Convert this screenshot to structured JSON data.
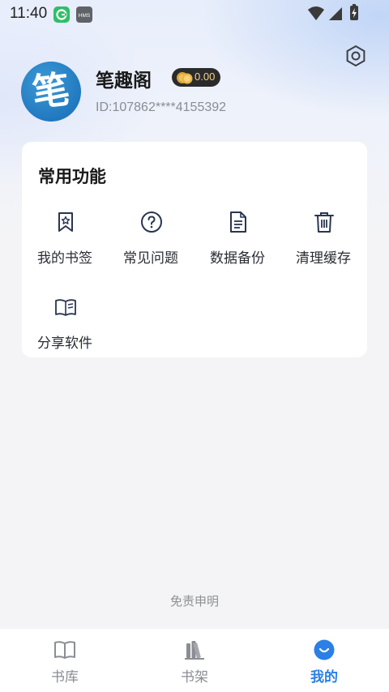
{
  "status_bar": {
    "time": "11:40",
    "app_icon_1": "browser-app-icon",
    "app_icon_2": "HMS"
  },
  "profile": {
    "avatar_glyph": "笔",
    "name": "笔趣阁",
    "coins": "0.00",
    "id_text": "ID:107862****4155392"
  },
  "functions": {
    "title": "常用功能",
    "items": [
      {
        "label": "我的书签",
        "icon": "bookmark-icon"
      },
      {
        "label": "常见问题",
        "icon": "help-icon"
      },
      {
        "label": "数据备份",
        "icon": "document-icon"
      },
      {
        "label": "清理缓存",
        "icon": "trash-icon"
      },
      {
        "label": "分享软件",
        "icon": "book-share-icon"
      }
    ]
  },
  "disclaimer": "免责申明",
  "bottom_nav": [
    {
      "label": "书库",
      "icon": "open-book-icon",
      "active": false
    },
    {
      "label": "书架",
      "icon": "bookshelf-icon",
      "active": false
    },
    {
      "label": "我的",
      "icon": "smile-icon",
      "active": true
    }
  ],
  "colors": {
    "accent": "#2b7fe6",
    "avatar_blue": "#1f76bd",
    "coin_badge": "#2b2b2b",
    "icon_stroke": "#2a3550"
  }
}
